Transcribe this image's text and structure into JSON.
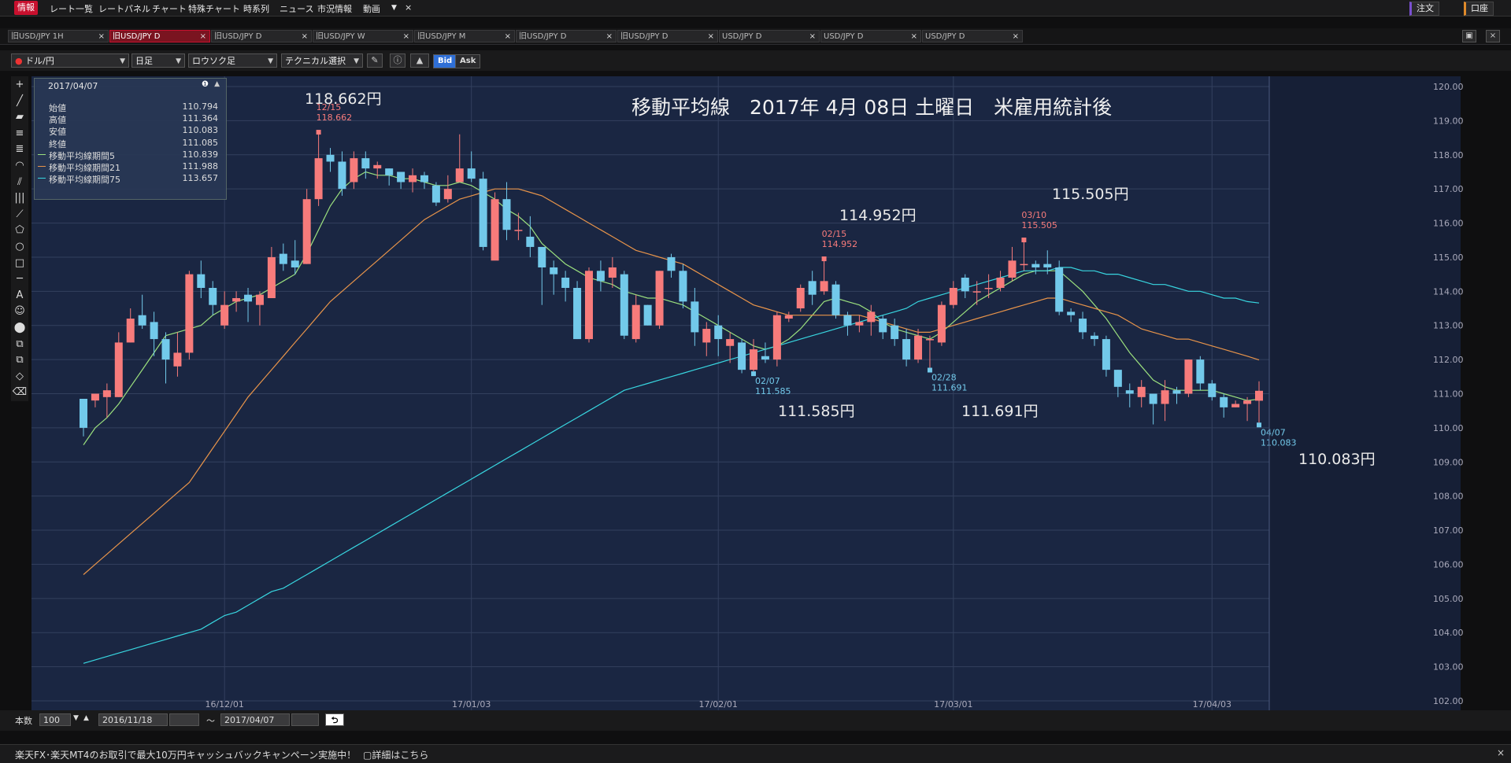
{
  "menu": {
    "items": [
      "情報",
      "レート一覧",
      "レートパネル",
      "チャート",
      "特殊チャート",
      "時系列",
      "ニュース",
      "市況情報",
      "動画"
    ],
    "more_icon": "dropdown-arrow-icon",
    "close_icon": "close-icon",
    "order_label": "注文",
    "account_label": "口座"
  },
  "tabs": [
    {
      "label": "旧USD/JPY 1H",
      "active": false
    },
    {
      "label": "旧USD/JPY D",
      "active": true
    },
    {
      "label": "旧USD/JPY D",
      "active": false
    },
    {
      "label": "旧USD/JPY W",
      "active": false
    },
    {
      "label": "旧USD/JPY M",
      "active": false
    },
    {
      "label": "旧USD/JPY D",
      "active": false
    },
    {
      "label": "旧USD/JPY D",
      "active": false
    },
    {
      "label": "USD/JPY D",
      "active": false
    },
    {
      "label": "USD/JPY D",
      "active": false
    },
    {
      "label": "USD/JPY D",
      "active": false
    }
  ],
  "toolbar": {
    "pair": "ドル/円",
    "period": "日足",
    "candle_type": "ロウソク足",
    "technical": "テクニカル選択",
    "bid": "Bid",
    "ask": "Ask"
  },
  "left_tools": [
    "crosshair-icon",
    "line-icon",
    "ruler-icon",
    "hlines-icon",
    "multiline-icon",
    "fan-icon",
    "fibo-icon",
    "grid-icon",
    "channel-icon",
    "pentagon-icon",
    "circle-icon",
    "rectangle-icon",
    "hline-icon",
    "text-icon",
    "emoji-icon",
    "clear-icon",
    "copy-icon",
    "layers-icon",
    "eraser-icon",
    "delete-icon"
  ],
  "ohlc_panel": {
    "date": "2017/04/07",
    "rows": [
      {
        "label": "始値",
        "value": "110.794",
        "color": ""
      },
      {
        "label": "高値",
        "value": "111.364",
        "color": ""
      },
      {
        "label": "安値",
        "value": "110.083",
        "color": ""
      },
      {
        "label": "終値",
        "value": "111.085",
        "color": ""
      },
      {
        "label": "移動平均線期間5",
        "value": "110.839",
        "color": "#9be07e"
      },
      {
        "label": "移動平均線期間21",
        "value": "111.988",
        "color": "#e8944a"
      },
      {
        "label": "移動平均線期間75",
        "value": "113.657",
        "color": "#38d6e0"
      }
    ]
  },
  "annotations": {
    "title": "移動平均線　2017年 4月 08日 土曜日　米雇用統計後",
    "labels": [
      "118.662円",
      "114.952円",
      "115.505円",
      "111.585円",
      "111.691円",
      "110.083円"
    ]
  },
  "bottom": {
    "count_label": "本数",
    "count_value": "100",
    "from_date": "2016/11/18",
    "tilde": "～",
    "to_date": "2017/04/07"
  },
  "ticker": {
    "text": "楽天FX･楽天MT4のお取引で最大10万円キャッシュバックキャンペーン実施中！",
    "link": "詳細はこちら"
  },
  "chart_data": {
    "type": "candlestick",
    "symbol": "USD/JPY",
    "ylim": [
      101.7,
      120.3
    ],
    "y_ticks": [
      "120.00",
      "119.00",
      "118.00",
      "117.00",
      "116.00",
      "115.00",
      "114.00",
      "113.00",
      "112.00",
      "111.00",
      "110.00",
      "109.00",
      "108.00",
      "107.00",
      "106.00",
      "105.00",
      "104.00",
      "103.00",
      "102.00"
    ],
    "x_ticks": [
      {
        "label": "16/12/01",
        "index": 12
      },
      {
        "label": "17/01/03",
        "index": 33
      },
      {
        "label": "17/02/01",
        "index": 54
      },
      {
        "label": "17/03/01",
        "index": 74
      },
      {
        "label": "17/04/03",
        "index": 96
      }
    ],
    "up_color": "#f77b7b",
    "down_color": "#72c9ea",
    "candles": [
      [
        110.85,
        110.0,
        110.6,
        109.75
      ],
      [
        110.8,
        111.0,
        110.9,
        110.6
      ],
      [
        110.9,
        111.1,
        111.3,
        110.3
      ],
      [
        110.9,
        112.5,
        112.8,
        110.9
      ],
      [
        112.5,
        113.2,
        113.5,
        112.5
      ],
      [
        113.3,
        113.0,
        113.9,
        112.9
      ],
      [
        113.1,
        112.6,
        113.4,
        112.1
      ],
      [
        112.6,
        112.0,
        112.8,
        111.3
      ],
      [
        111.8,
        112.2,
        112.8,
        111.5
      ],
      [
        112.2,
        114.5,
        114.6,
        112.0
      ],
      [
        114.5,
        114.1,
        114.9,
        113.8
      ],
      [
        114.1,
        113.6,
        114.3,
        113.3
      ],
      [
        113.0,
        113.6,
        114.0,
        112.9
      ],
      [
        113.7,
        113.8,
        114.0,
        113.4
      ],
      [
        113.9,
        113.7,
        114.1,
        113.1
      ],
      [
        113.6,
        113.9,
        114.0,
        113.0
      ],
      [
        113.8,
        115.0,
        115.3,
        113.8
      ],
      [
        115.1,
        114.8,
        115.4,
        114.6
      ],
      [
        114.9,
        114.7,
        115.5,
        114.5
      ],
      [
        114.8,
        116.7,
        117.0,
        114.8
      ],
      [
        116.7,
        117.9,
        118.662,
        116.5
      ],
      [
        118.0,
        117.8,
        118.2,
        117.5
      ],
      [
        117.8,
        117.0,
        118.1,
        116.8
      ],
      [
        117.2,
        117.9,
        118.1,
        117.0
      ],
      [
        117.9,
        117.6,
        118.1,
        117.3
      ],
      [
        117.6,
        117.7,
        117.8,
        117.3
      ],
      [
        117.6,
        117.4,
        117.6,
        117.1
      ],
      [
        117.5,
        117.2,
        117.4,
        117.0
      ],
      [
        117.2,
        117.4,
        117.6,
        116.9
      ],
      [
        117.4,
        117.2,
        117.5,
        117.0
      ],
      [
        117.1,
        116.6,
        117.2,
        116.5
      ],
      [
        116.7,
        117.0,
        117.4,
        116.6
      ],
      [
        117.2,
        117.6,
        118.6,
        117.2
      ],
      [
        117.6,
        117.3,
        118.1,
        117.2
      ],
      [
        117.3,
        115.3,
        117.5,
        115.2
      ],
      [
        114.9,
        116.7,
        116.9,
        115.2
      ],
      [
        116.7,
        115.8,
        117.2,
        115.5
      ],
      [
        115.8,
        115.8,
        116.3,
        115.5
      ],
      [
        115.6,
        115.3,
        116.2,
        115.0
      ],
      [
        115.3,
        114.7,
        115.3,
        113.6
      ],
      [
        114.7,
        114.5,
        114.9,
        113.9
      ],
      [
        114.4,
        114.1,
        114.6,
        113.7
      ],
      [
        114.1,
        112.6,
        114.3,
        112.6
      ],
      [
        112.6,
        114.6,
        114.7,
        112.5
      ],
      [
        114.6,
        114.3,
        114.9,
        114.0
      ],
      [
        114.4,
        114.7,
        115.0,
        114.1
      ],
      [
        114.5,
        112.7,
        114.6,
        112.6
      ],
      [
        112.6,
        113.6,
        113.9,
        112.5
      ],
      [
        113.6,
        113.0,
        113.6,
        113.0
      ],
      [
        113.0,
        114.6,
        114.6,
        112.9
      ],
      [
        115.0,
        114.6,
        115.1,
        114.4
      ],
      [
        114.6,
        113.7,
        114.8,
        113.5
      ],
      [
        113.7,
        112.8,
        114.1,
        112.4
      ],
      [
        112.5,
        112.9,
        113.1,
        112.1
      ],
      [
        113.0,
        112.6,
        113.3,
        112.1
      ],
      [
        112.4,
        112.6,
        112.8,
        111.9
      ],
      [
        112.5,
        111.7,
        112.6,
        111.6
      ],
      [
        111.7,
        112.3,
        112.6,
        111.585
      ],
      [
        112.1,
        112.0,
        112.5,
        111.9
      ],
      [
        112.0,
        113.3,
        113.4,
        111.8
      ],
      [
        113.2,
        113.3,
        113.4,
        113.1
      ],
      [
        113.5,
        114.1,
        114.2,
        113.4
      ],
      [
        114.3,
        113.9,
        114.6,
        113.6
      ],
      [
        114.0,
        114.3,
        114.952,
        113.9
      ],
      [
        114.2,
        113.3,
        114.3,
        113.2
      ],
      [
        113.3,
        113.0,
        113.4,
        112.7
      ],
      [
        113.0,
        113.1,
        113.3,
        112.8
      ],
      [
        113.1,
        113.4,
        113.6,
        112.7
      ],
      [
        113.2,
        112.8,
        113.3,
        112.6
      ],
      [
        113.0,
        112.6,
        113.2,
        112.4
      ],
      [
        112.6,
        112.0,
        112.9,
        111.8
      ],
      [
        112.0,
        112.7,
        112.9,
        111.9
      ],
      [
        112.6,
        112.6,
        112.7,
        111.691
      ],
      [
        112.5,
        113.6,
        113.7,
        112.4
      ],
      [
        113.6,
        114.1,
        114.3,
        113.5
      ],
      [
        114.4,
        114.0,
        114.5,
        113.8
      ],
      [
        114.0,
        114.0,
        114.3,
        113.6
      ],
      [
        114.1,
        114.1,
        114.5,
        113.8
      ],
      [
        114.1,
        114.4,
        114.6,
        114.0
      ],
      [
        114.4,
        114.9,
        115.3,
        114.3
      ],
      [
        114.8,
        114.8,
        115.505,
        114.6
      ],
      [
        114.8,
        114.7,
        114.9,
        114.5
      ],
      [
        114.8,
        114.7,
        115.2,
        114.5
      ],
      [
        114.7,
        113.4,
        114.9,
        113.3
      ],
      [
        113.4,
        113.3,
        113.5,
        113.1
      ],
      [
        113.2,
        112.8,
        113.4,
        112.6
      ],
      [
        112.7,
        112.6,
        112.8,
        112.4
      ],
      [
        112.6,
        111.7,
        112.7,
        111.5
      ],
      [
        111.7,
        111.2,
        111.7,
        110.9
      ],
      [
        111.1,
        111.0,
        111.3,
        110.6
      ],
      [
        110.9,
        111.2,
        111.4,
        110.6
      ],
      [
        111.0,
        110.7,
        111.0,
        110.1
      ],
      [
        110.7,
        111.1,
        111.4,
        110.2
      ],
      [
        111.1,
        111.0,
        111.2,
        110.7
      ],
      [
        111.0,
        112.0,
        112.0,
        110.9
      ],
      [
        112.0,
        111.3,
        112.1,
        111.1
      ],
      [
        111.3,
        110.9,
        111.4,
        110.8
      ],
      [
        110.9,
        110.6,
        111.0,
        110.3
      ],
      [
        110.6,
        110.7,
        110.8,
        110.6
      ],
      [
        110.7,
        110.8,
        110.9,
        110.2
      ],
      [
        110.794,
        111.085,
        111.364,
        110.083
      ]
    ],
    "series": [
      {
        "name": "移動平均線期間5",
        "color": "#9be07e",
        "values": [
          109.5,
          110.0,
          110.3,
          110.7,
          111.2,
          111.7,
          112.2,
          112.7,
          112.8,
          112.9,
          113.0,
          113.3,
          113.5,
          113.7,
          113.8,
          113.9,
          114.1,
          114.3,
          114.5,
          115.1,
          115.8,
          116.5,
          117.0,
          117.3,
          117.5,
          117.4,
          117.4,
          117.3,
          117.3,
          117.2,
          117.1,
          117.1,
          117.2,
          117.1,
          116.9,
          116.7,
          116.4,
          116.2,
          115.9,
          115.4,
          115.1,
          114.8,
          114.6,
          114.4,
          114.3,
          114.2,
          114.0,
          113.9,
          113.8,
          113.8,
          113.7,
          113.6,
          113.4,
          113.2,
          113.0,
          112.8,
          112.6,
          112.4,
          112.3,
          112.4,
          112.6,
          112.9,
          113.3,
          113.7,
          113.8,
          113.7,
          113.6,
          113.4,
          113.1,
          112.9,
          112.8,
          112.7,
          112.6,
          112.8,
          113.1,
          113.4,
          113.7,
          113.9,
          114.1,
          114.3,
          114.5,
          114.6,
          114.6,
          114.6,
          114.3,
          114.0,
          113.6,
          113.2,
          112.7,
          112.2,
          111.8,
          111.4,
          111.2,
          111.1,
          111.1,
          111.1,
          111.1,
          111.0,
          110.9,
          110.8,
          110.839
        ]
      },
      {
        "name": "移動平均線期間21",
        "color": "#e8944a",
        "values": [
          105.7,
          106.0,
          106.3,
          106.6,
          106.9,
          107.2,
          107.5,
          107.8,
          108.1,
          108.4,
          108.9,
          109.4,
          109.9,
          110.4,
          110.9,
          111.3,
          111.7,
          112.1,
          112.5,
          112.9,
          113.3,
          113.7,
          114.0,
          114.3,
          114.6,
          114.9,
          115.2,
          115.5,
          115.8,
          116.1,
          116.3,
          116.5,
          116.7,
          116.8,
          116.9,
          117.0,
          117.0,
          117.0,
          116.9,
          116.8,
          116.6,
          116.4,
          116.2,
          116.0,
          115.8,
          115.6,
          115.4,
          115.2,
          115.1,
          115.0,
          114.9,
          114.8,
          114.6,
          114.4,
          114.2,
          114.0,
          113.8,
          113.6,
          113.5,
          113.4,
          113.3,
          113.3,
          113.3,
          113.3,
          113.3,
          113.3,
          113.3,
          113.2,
          113.1,
          113.0,
          112.9,
          112.8,
          112.8,
          112.9,
          113.0,
          113.1,
          113.2,
          113.3,
          113.4,
          113.5,
          113.6,
          113.7,
          113.8,
          113.8,
          113.7,
          113.6,
          113.5,
          113.4,
          113.3,
          113.1,
          112.9,
          112.8,
          112.7,
          112.6,
          112.6,
          112.5,
          112.4,
          112.3,
          112.2,
          112.1,
          111.988
        ]
      },
      {
        "name": "移動平均線期間75",
        "color": "#38d6e0",
        "values": [
          103.1,
          103.2,
          103.3,
          103.4,
          103.5,
          103.6,
          103.7,
          103.8,
          103.9,
          104.0,
          104.1,
          104.3,
          104.5,
          104.6,
          104.8,
          105.0,
          105.2,
          105.3,
          105.5,
          105.7,
          105.9,
          106.1,
          106.3,
          106.5,
          106.7,
          106.9,
          107.1,
          107.3,
          107.5,
          107.7,
          107.9,
          108.1,
          108.3,
          108.5,
          108.7,
          108.9,
          109.1,
          109.3,
          109.5,
          109.7,
          109.9,
          110.1,
          110.3,
          110.5,
          110.7,
          110.9,
          111.1,
          111.2,
          111.3,
          111.4,
          111.5,
          111.6,
          111.7,
          111.8,
          111.9,
          112.0,
          112.1,
          112.2,
          112.3,
          112.4,
          112.5,
          112.6,
          112.7,
          112.8,
          112.9,
          113.0,
          113.1,
          113.2,
          113.3,
          113.4,
          113.5,
          113.7,
          113.8,
          113.9,
          114.0,
          114.1,
          114.2,
          114.3,
          114.4,
          114.5,
          114.6,
          114.6,
          114.6,
          114.7,
          114.7,
          114.6,
          114.6,
          114.5,
          114.5,
          114.4,
          114.3,
          114.2,
          114.2,
          114.1,
          114.0,
          114.0,
          113.9,
          113.8,
          113.8,
          113.7,
          113.657
        ]
      }
    ],
    "extreme_marks": [
      {
        "index": 20,
        "date": "12/15",
        "value": "118.662",
        "pos": "high",
        "color": "#f77b7b"
      },
      {
        "index": 63,
        "date": "02/15",
        "value": "114.952",
        "pos": "high",
        "color": "#f77b7b"
      },
      {
        "index": 80,
        "date": "03/10",
        "value": "115.505",
        "pos": "high",
        "color": "#f77b7b"
      },
      {
        "index": 57,
        "date": "02/07",
        "value": "111.585",
        "pos": "low",
        "color": "#72c9ea"
      },
      {
        "index": 72,
        "date": "02/28",
        "value": "111.691",
        "pos": "low",
        "color": "#72c9ea"
      },
      {
        "index": 100,
        "date": "04/07",
        "value": "110.083",
        "pos": "low",
        "color": "#72c9ea"
      }
    ]
  }
}
